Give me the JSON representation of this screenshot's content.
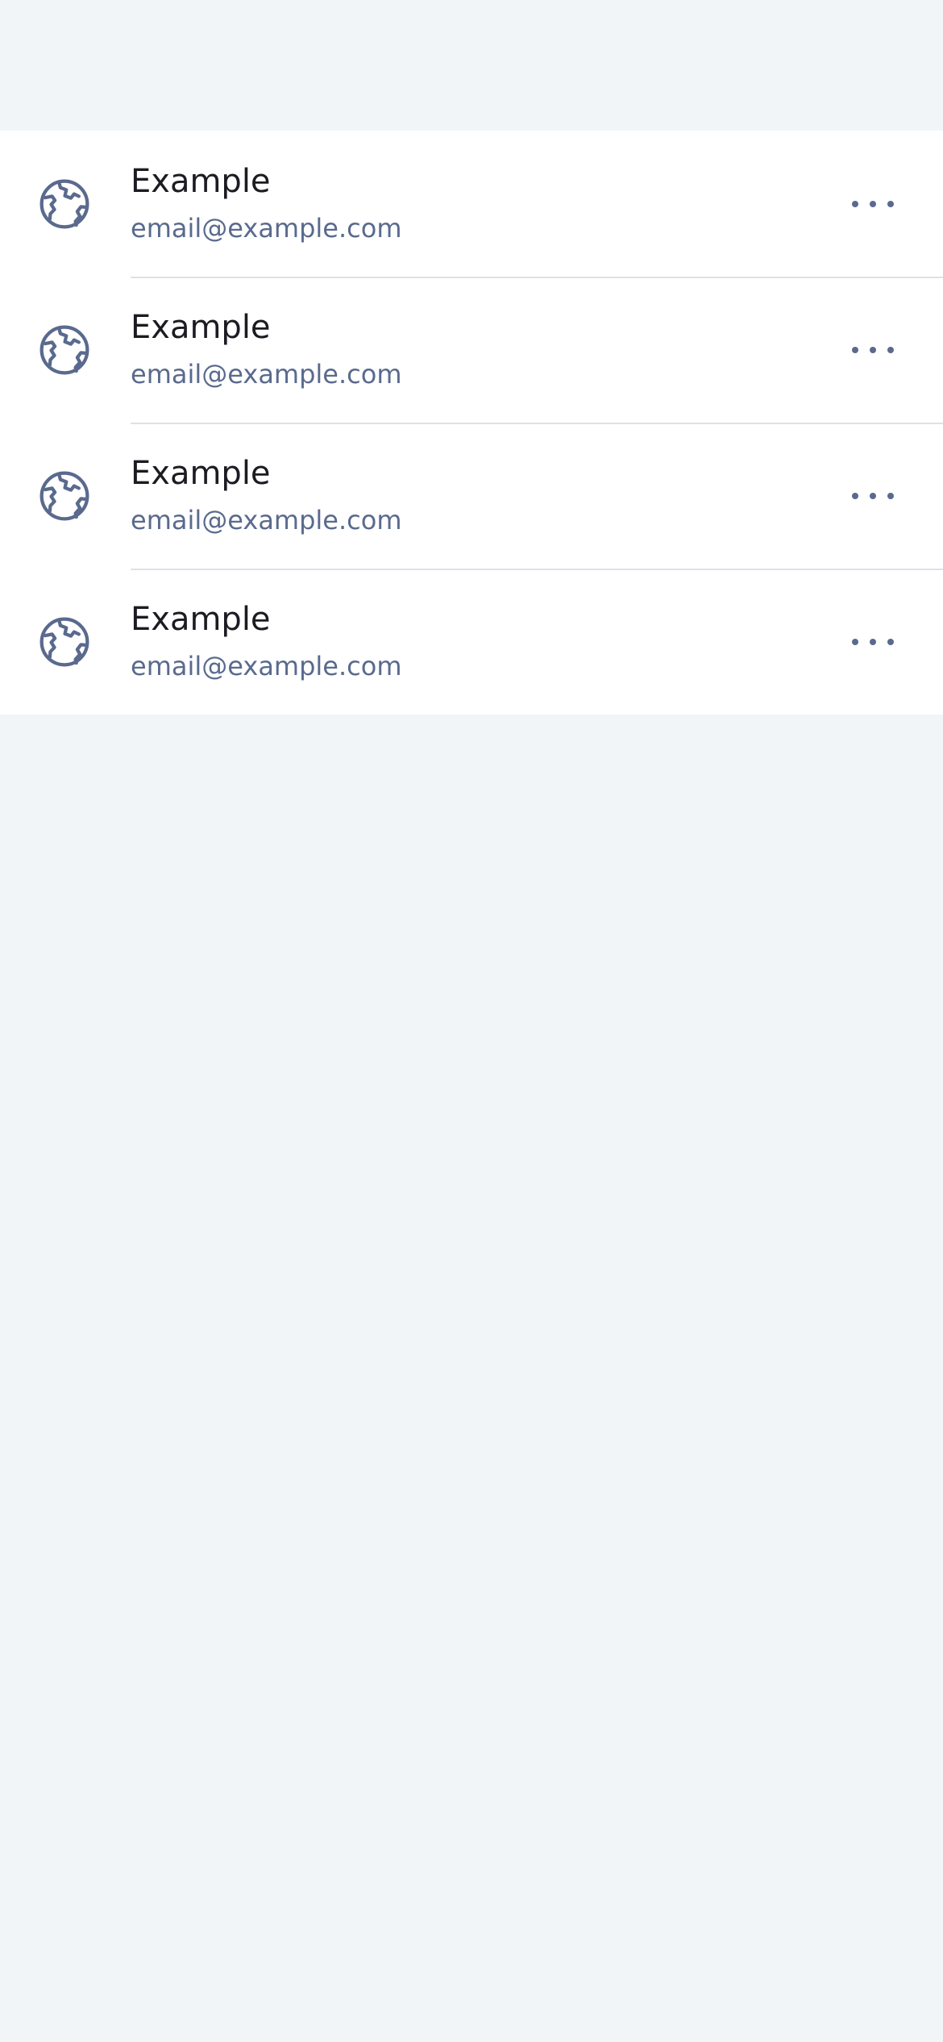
{
  "accounts": {
    "items": [
      {
        "title": "Example",
        "email": "email@example.com",
        "icon": "globe-icon",
        "action_icon": "more-horizontal-icon"
      },
      {
        "title": "Example",
        "email": "email@example.com",
        "icon": "globe-icon",
        "action_icon": "more-horizontal-icon"
      },
      {
        "title": "Example",
        "email": "email@example.com",
        "icon": "globe-icon",
        "action_icon": "more-horizontal-icon"
      },
      {
        "title": "Example",
        "email": "email@example.com",
        "icon": "globe-icon",
        "action_icon": "more-horizontal-icon"
      }
    ]
  },
  "colors": {
    "background": "#f1f5f8",
    "list_background": "#ffffff",
    "title_text": "#1b1b22",
    "secondary_text": "#5a6a8e",
    "divider": "#dde1e7"
  }
}
